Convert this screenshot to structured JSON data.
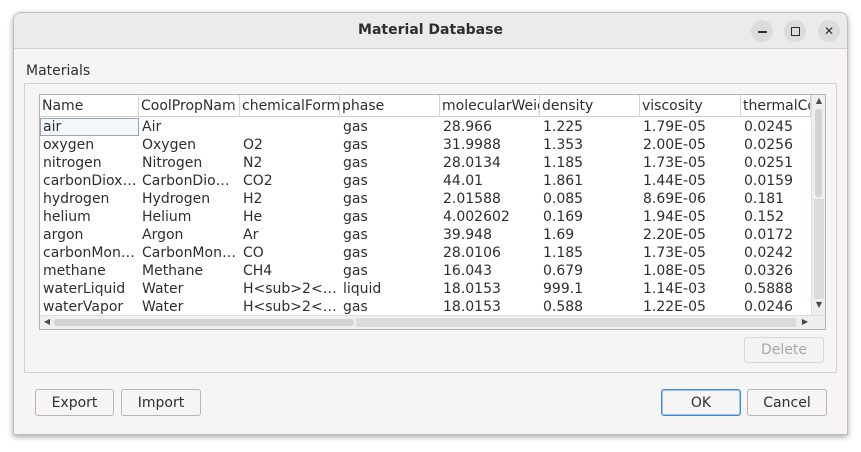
{
  "window": {
    "title": "Material Database"
  },
  "group": {
    "label": "Materials"
  },
  "table": {
    "columns": [
      "Name",
      "CoolPropName",
      "chemicalFormula",
      "phase",
      "molecularWeight",
      "density",
      "viscosity",
      "thermalConductivity"
    ],
    "columns_visible": [
      "Name",
      "CoolPropNam",
      "chemicalFormu",
      "phase",
      "molecularWeig",
      "density",
      "viscosity",
      "thermalCo"
    ],
    "rows": [
      [
        "air",
        "Air",
        "",
        "gas",
        "28.966",
        "1.225",
        "1.79E-05",
        "0.0245"
      ],
      [
        "oxygen",
        "Oxygen",
        "O2",
        "gas",
        "31.9988",
        "1.353",
        "2.00E-05",
        "0.0256"
      ],
      [
        "nitrogen",
        "Nitrogen",
        "N2",
        "gas",
        "28.0134",
        "1.185",
        "1.73E-05",
        "0.0251"
      ],
      [
        "carbonDiox…",
        "CarbonDio…",
        "CO2",
        "gas",
        "44.01",
        "1.861",
        "1.44E-05",
        "0.0159"
      ],
      [
        "hydrogen",
        "Hydrogen",
        "H2",
        "gas",
        "2.01588",
        "0.085",
        "8.69E-06",
        "0.181"
      ],
      [
        "helium",
        "Helium",
        "He",
        "gas",
        "4.002602",
        "0.169",
        "1.94E-05",
        "0.152"
      ],
      [
        "argon",
        "Argon",
        "Ar",
        "gas",
        "39.948",
        "1.69",
        "2.20E-05",
        "0.0172"
      ],
      [
        "carbonMon…",
        "CarbonMon…",
        "CO",
        "gas",
        "28.0106",
        "1.185",
        "1.73E-05",
        "0.0242"
      ],
      [
        "methane",
        "Methane",
        "CH4",
        "gas",
        "16.043",
        "0.679",
        "1.08E-05",
        "0.0326"
      ],
      [
        "waterLiquid",
        "Water",
        "H<sub>2</…",
        "liquid",
        "18.0153",
        "999.1",
        "1.14E-03",
        "0.5888"
      ],
      [
        "waterVapor",
        "Water",
        "H<sub>2</…",
        "gas",
        "18.0153",
        "0.588",
        "1.22E-05",
        "0.0246"
      ]
    ]
  },
  "buttons": {
    "delete": "Delete",
    "export": "Export",
    "import": "Import",
    "ok": "OK",
    "cancel": "Cancel"
  },
  "icons": {
    "minimize": "minimize-icon",
    "maximize": "maximize-icon",
    "close": "close-icon",
    "scroll_up": "arrow-up-icon",
    "scroll_down": "arrow-down-icon",
    "scroll_left": "arrow-left-icon",
    "scroll_right": "arrow-right-icon"
  },
  "colors": {
    "ok_border": "#3d8ae5",
    "selected_cell_border": "#9aa5b3"
  }
}
